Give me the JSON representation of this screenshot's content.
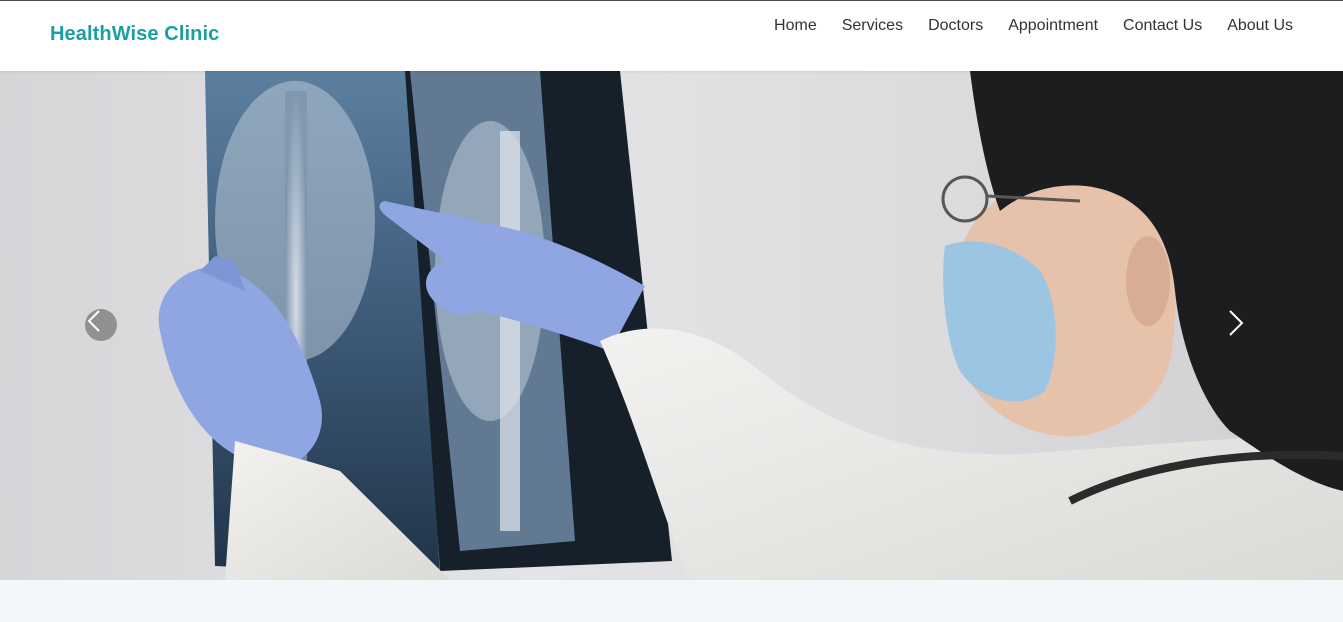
{
  "header": {
    "brand": "HealthWise Clinic",
    "brand_color": "#1a9fa3",
    "nav": [
      {
        "label": "Home"
      },
      {
        "label": "Services"
      },
      {
        "label": "Doctors"
      },
      {
        "label": "Appointment"
      },
      {
        "label": "Contact Us"
      },
      {
        "label": "About Us"
      }
    ]
  },
  "hero": {
    "image": "doctor-examining-xray-photo",
    "prev_icon": "chevron-left-icon",
    "next_icon": "chevron-right-icon"
  }
}
